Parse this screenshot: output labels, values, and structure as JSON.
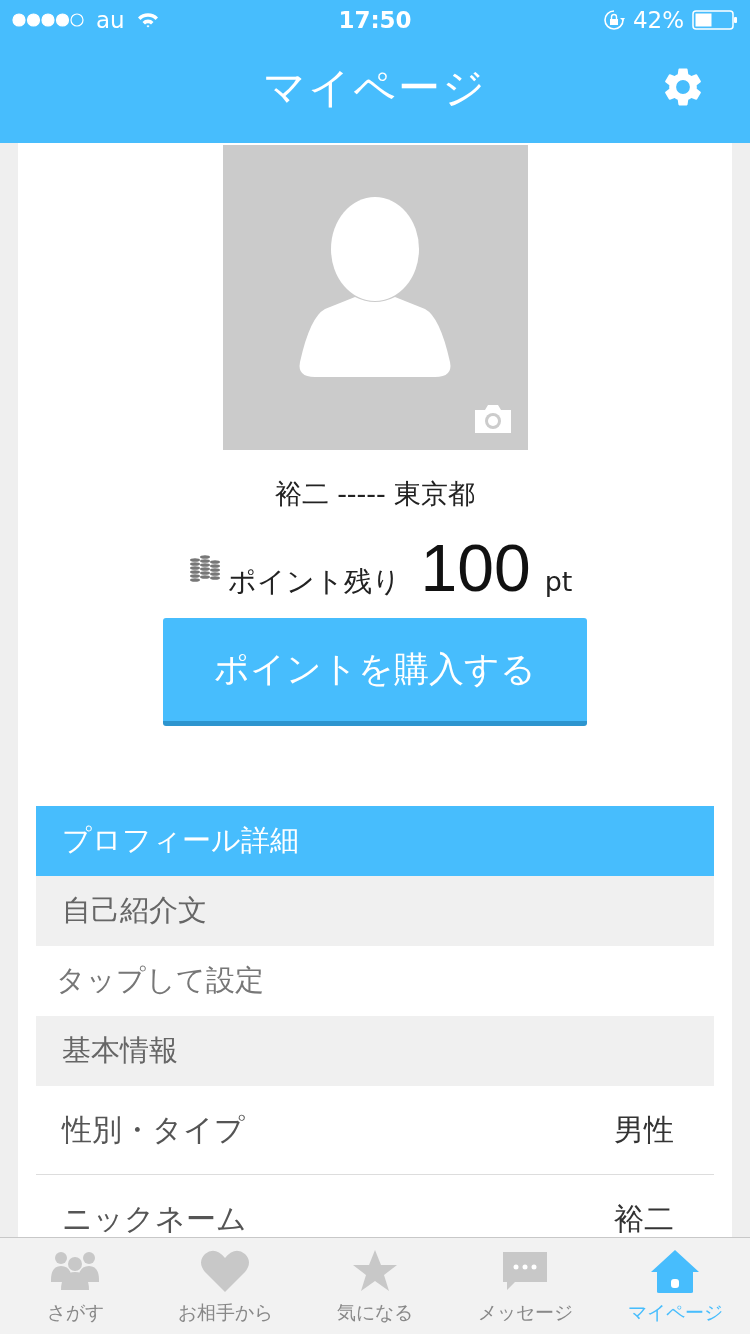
{
  "status_bar": {
    "carrier": "au",
    "time": "17:50",
    "battery": "42%"
  },
  "header": {
    "title": "マイページ"
  },
  "profile": {
    "name_line": "裕二 ----- 東京都",
    "points_label": "ポイント残り",
    "points_value": "100",
    "points_unit": "pt",
    "buy_button": "ポイントを購入する"
  },
  "section": {
    "title": "プロフィール詳細"
  },
  "rows": [
    {
      "kind": "subheader",
      "label": "自己紹介文"
    },
    {
      "kind": "hint",
      "label": "タップして設定"
    },
    {
      "kind": "subheader",
      "label": "基本情報"
    },
    {
      "kind": "field",
      "label": "性別・タイプ",
      "value": "男性"
    },
    {
      "kind": "field",
      "label": "ニックネーム",
      "value": "裕二"
    }
  ],
  "tabs": [
    {
      "label": "さがす",
      "selected": false
    },
    {
      "label": "お相手から",
      "selected": false
    },
    {
      "label": "気になる",
      "selected": false
    },
    {
      "label": "メッセージ",
      "selected": false
    },
    {
      "label": "マイページ",
      "selected": true
    }
  ]
}
